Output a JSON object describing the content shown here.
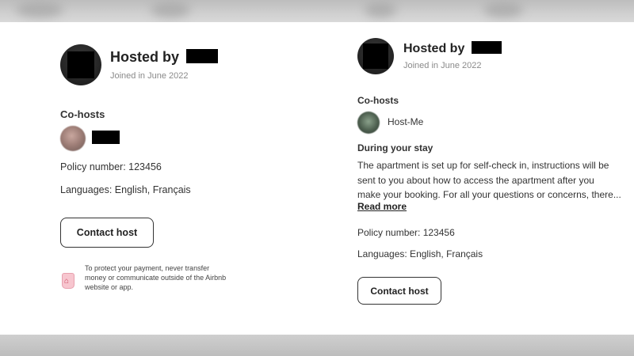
{
  "left_card": {
    "hosted_by": "Hosted by",
    "joined": "Joined in June 2022",
    "cohosts_title": "Co-hosts",
    "policy": "Policy number: 123456",
    "languages": "Languages: English, Français",
    "contact_button": "Contact host",
    "notice_lines": [
      "To protect your payment, never transfer",
      "money or communicate outside of the Airbnb",
      "website or app."
    ]
  },
  "right_card": {
    "hosted_by": "Hosted by",
    "joined": "Joined in June 2022",
    "cohosts_title": "Co-hosts",
    "cohost_name": "Host-Me",
    "stay_title": "During your stay",
    "stay_lines": [
      "The apartment is set up for self-check in, instructions will be",
      "sent to you about how to access the apartment after you",
      "make your booking. For all your questions or concerns, there..."
    ],
    "read_more": "Read more",
    "policy": "Policy number: 123456",
    "languages": "Languages: English, Français",
    "contact_button": "Contact host"
  },
  "icons": {
    "payment_protection": "airbnb-shield-icon"
  },
  "colors": {
    "redaction": "#000000",
    "shield_pink": "#f7c6cf"
  }
}
